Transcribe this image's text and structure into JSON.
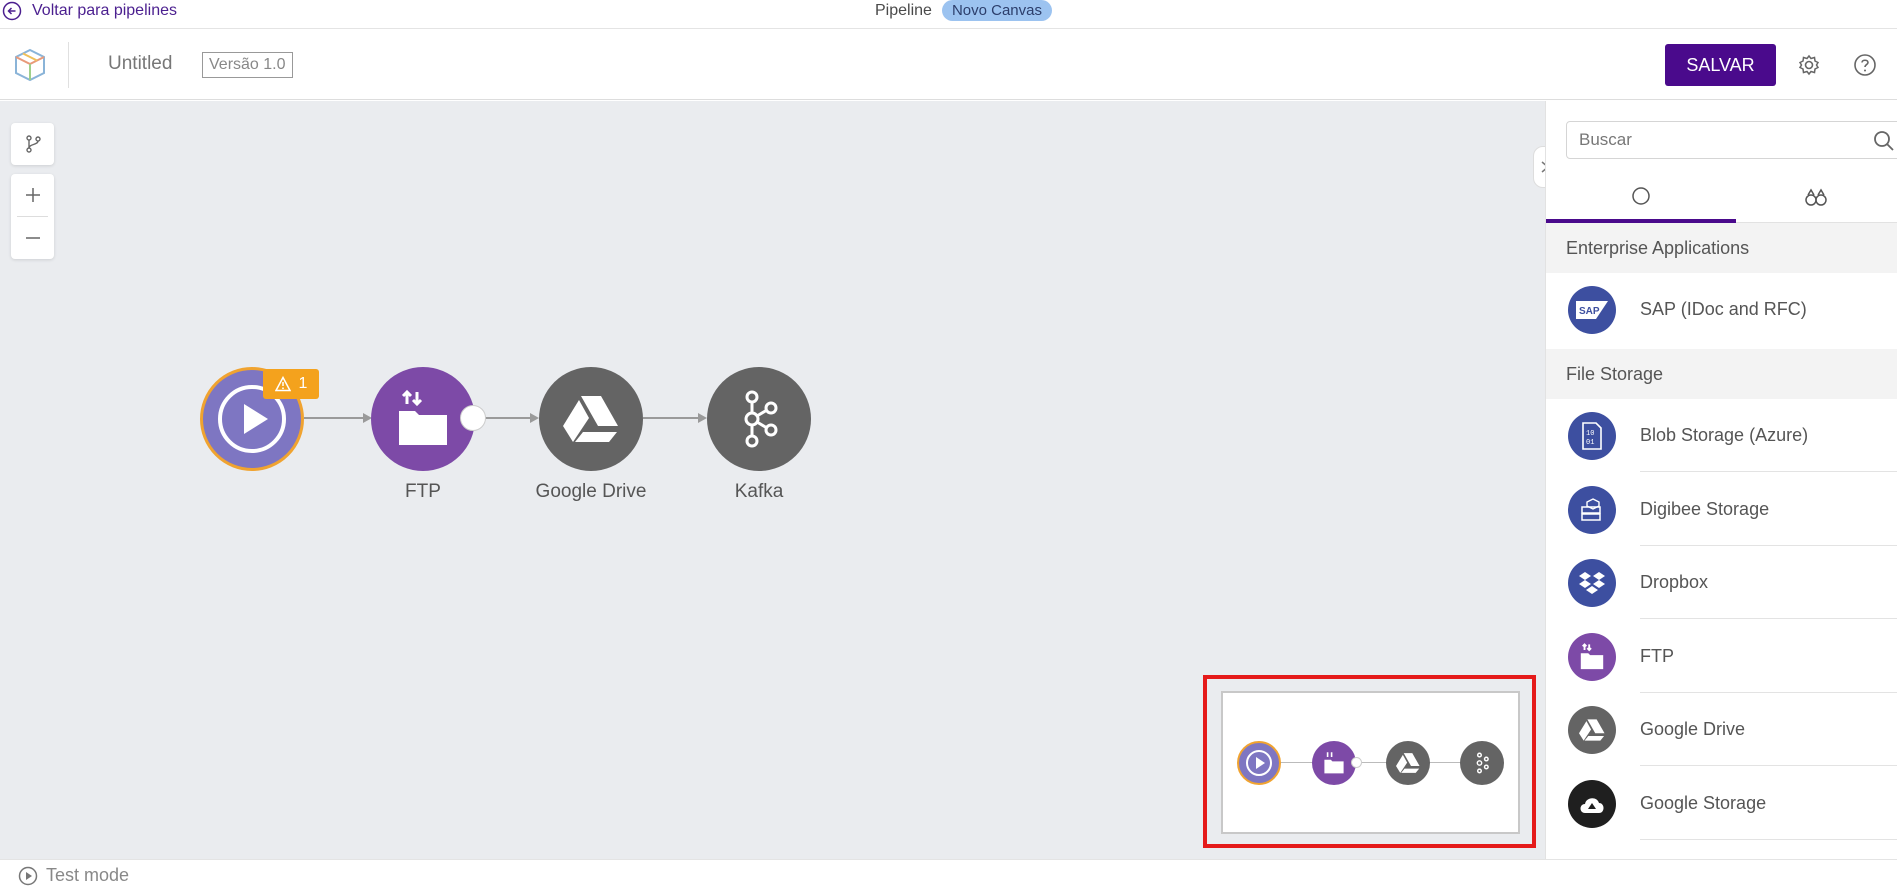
{
  "topbar": {
    "back_label": "Voltar para pipelines",
    "crumb_label": "Pipeline",
    "badge": "Novo Canvas"
  },
  "header": {
    "title": "Untitled",
    "version": "Versão 1.0",
    "save_label": "SALVAR"
  },
  "canvas": {
    "warning_count": "1",
    "nodes": [
      {
        "name": "trigger",
        "label": ""
      },
      {
        "name": "ftp",
        "label": "FTP"
      },
      {
        "name": "google-drive",
        "label": "Google Drive"
      },
      {
        "name": "kafka",
        "label": "Kafka"
      }
    ]
  },
  "sidebar": {
    "search_placeholder": "Buscar",
    "sections": [
      {
        "title": "Enterprise Applications",
        "items": [
          {
            "label": "SAP (IDoc and RFC)",
            "icon": "sap-icon"
          }
        ]
      },
      {
        "title": "File Storage",
        "items": [
          {
            "label": "Blob Storage (Azure)",
            "icon": "blob-storage-icon"
          },
          {
            "label": "Digibee Storage",
            "icon": "digibee-storage-icon"
          },
          {
            "label": "Dropbox",
            "icon": "dropbox-icon"
          },
          {
            "label": "FTP",
            "icon": "ftp-icon"
          },
          {
            "label": "Google Drive",
            "icon": "google-drive-icon"
          },
          {
            "label": "Google Storage",
            "icon": "google-storage-icon"
          }
        ]
      }
    ]
  },
  "footer": {
    "test_mode_label": "Test mode"
  },
  "colors": {
    "brand": "#4a0a8c",
    "trigger": "#7e76c2",
    "ftp": "#7d4aa7",
    "node_gray": "#646464",
    "sap_blue": "#3d4fa0",
    "warning": "#f4a21d",
    "highlight": "#e51a1a"
  }
}
